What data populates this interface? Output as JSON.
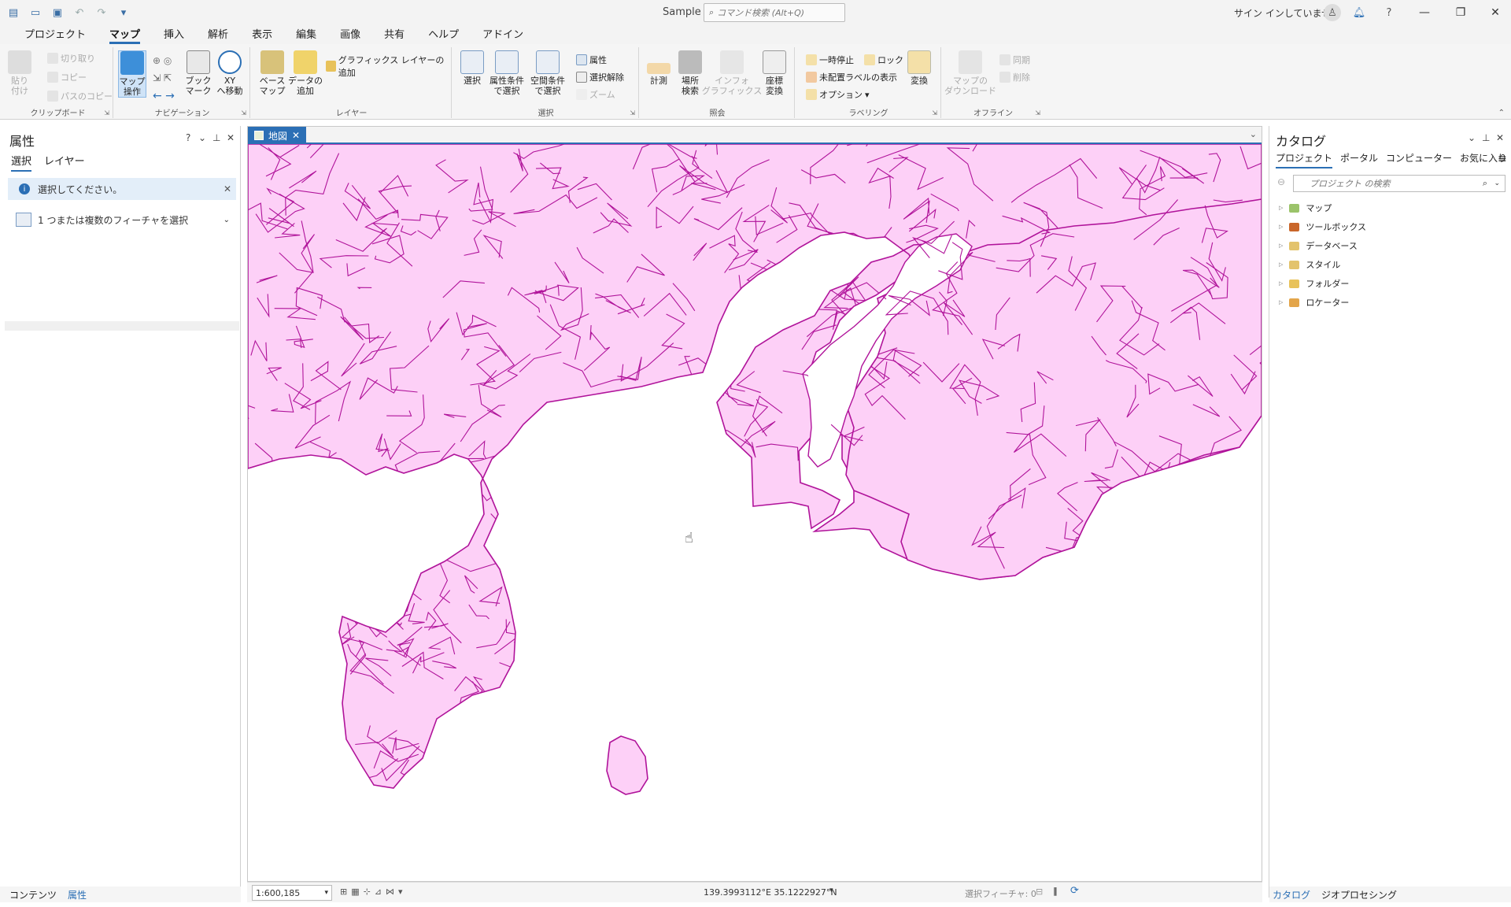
{
  "titlebar": {
    "title": "Sample",
    "command_search_placeholder": "コマンド検索 (Alt+Q)",
    "signin": "サイン インしていません"
  },
  "tabs": [
    "プロジェクト",
    "マップ",
    "挿入",
    "解析",
    "表示",
    "編集",
    "画像",
    "共有",
    "ヘルプ",
    "アドイン"
  ],
  "active_tab": "マップ",
  "ribbon": {
    "clipboard": {
      "group_label": "クリップボード",
      "paste": "貼り付け",
      "cut": "切り取り",
      "copy": "コピー",
      "copy_path": "パスのコピー"
    },
    "navigation": {
      "group_label": "ナビゲーション",
      "explore": "マップ\n操作",
      "bookmarks": "ブック\nマーク",
      "goto_xy": "XY\nへ移動"
    },
    "layer": {
      "group_label": "レイヤー",
      "basemap": "ベース\nマップ",
      "add_data": "データの\n追加",
      "add_graphics": "グラフィックス レイヤーの追加"
    },
    "selection": {
      "group_label": "選択",
      "select": "選択",
      "select_by_attr": "属性条件\nで選択",
      "select_by_loc": "空間条件\nで選択",
      "attributes": "属性",
      "clear": "選択解除",
      "zoom": "ズーム"
    },
    "inquiry": {
      "group_label": "照会",
      "measure": "計測",
      "locate": "場所\n検索",
      "infographics": "インフォ\nグラフィックス",
      "coord_conv": "座標\n変換"
    },
    "labeling": {
      "group_label": "ラベリング",
      "pause": "一時停止",
      "lock": "ロック",
      "unplaced": "未配置ラベルの表示",
      "options": "オプション",
      "convert": "変換"
    },
    "offline": {
      "group_label": "オフライン",
      "download": "マップの\nダウンロード",
      "sync": "同期",
      "remove": "削除"
    }
  },
  "left_pane": {
    "title": "属性",
    "tabs": [
      "選択",
      "レイヤー"
    ],
    "info_message": "選択してください。",
    "select_features": "1 つまたは複数のフィーチャを選択",
    "bottom_tabs": [
      "コンテンツ",
      "属性"
    ]
  },
  "map": {
    "tab_label": "地図",
    "scale": "1:600,185",
    "coordinates": "139.3993112°E 35.1222927°N",
    "selected_features": "選択フィーチャ: 0",
    "land_color": "#fdd0f7",
    "boundary_color": "#b0139a"
  },
  "catalog": {
    "title": "カタログ",
    "tabs": [
      "プロジェクト",
      "ポータル",
      "コンピューター",
      "お気に入り"
    ],
    "search_placeholder": "プロジェクト の検索",
    "items": [
      "マップ",
      "ツールボックス",
      "データベース",
      "スタイル",
      "フォルダー",
      "ロケーター"
    ],
    "bottom_tabs": [
      "カタログ",
      "ジオプロセシング"
    ]
  }
}
